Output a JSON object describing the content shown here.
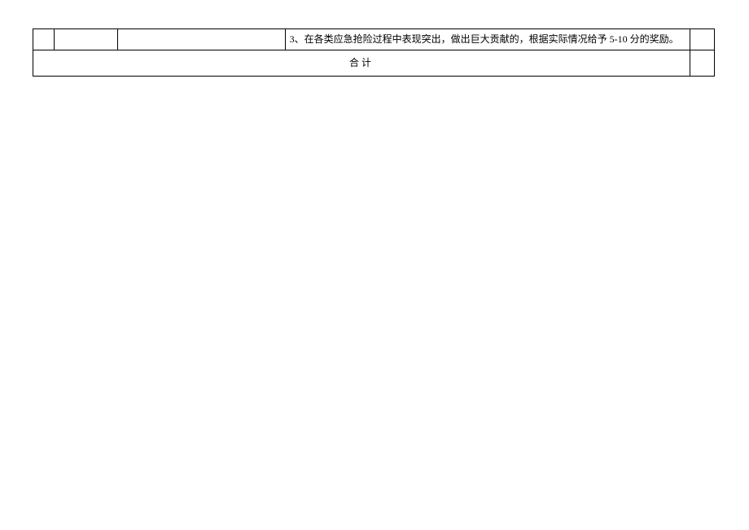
{
  "table": {
    "row1": {
      "col1": "",
      "col2": "",
      "col3": "",
      "col4": "3、在各类应急抢险过程中表现突出，做出巨大贡献的，根据实际情况给予 5-10 分的奖励。",
      "col5": ""
    },
    "total": {
      "label": "合计",
      "value": ""
    }
  }
}
